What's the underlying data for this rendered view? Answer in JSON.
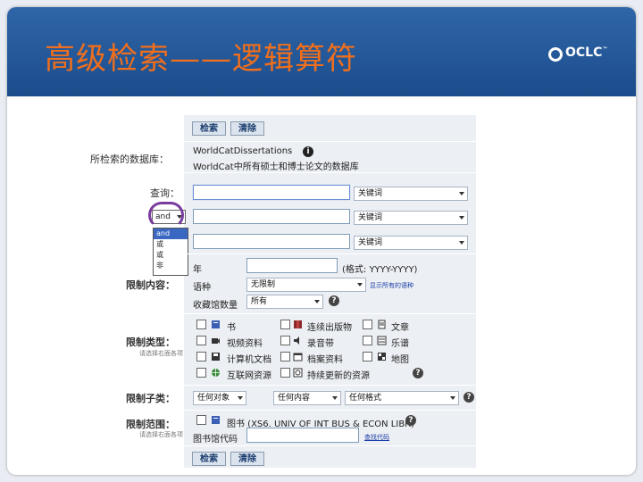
{
  "slide": {
    "title": "高级检索——逻辑算符",
    "logo_text": "OCLC",
    "logo_tm": "™"
  },
  "form": {
    "buttons": {
      "search": "检索",
      "clear": "清除"
    },
    "database": {
      "label": "所检索的数据库：",
      "line1": "WorldCatDissertations",
      "line2": "WorldCat中所有硕士和博士论文的数据库"
    },
    "query": {
      "label": "查询：",
      "field_select": "关键词",
      "operator": "and",
      "operator_options": [
        "and",
        "或",
        "或",
        "非"
      ]
    },
    "limits": {
      "label": "限制内容：",
      "year_label": "年",
      "year_format": "(格式: YYYY-YYYY)",
      "language_label": "语种",
      "language_value": "无限制",
      "language_link": "显示所有的语种",
      "holdings_label": "收藏馆数量",
      "holdings_value": "所有"
    },
    "types": {
      "label": "限制类型：",
      "sub": "请选择右面各项",
      "items": [
        "书",
        "连续出版物",
        "文章",
        "视频资料",
        "录音带",
        "乐谱",
        "计算机文档",
        "档案资料",
        "地图",
        "互联网资源",
        "持续更新的资源"
      ]
    },
    "subtypes": {
      "label": "限制子类：",
      "any_audience": "任何对象",
      "any_content": "任何内容",
      "any_format": "任何格式"
    },
    "scope": {
      "label": "限制范围：",
      "sub": "请选择右面各项",
      "library_item": "图书 (XS6. UNIV OF INT BUS & ECON LIBR)",
      "library_code_label": "图书馆代码",
      "library_code_link": "查找代码"
    }
  },
  "colors": {
    "banner": "#1b4c8b",
    "title": "#ef6f1d",
    "panel": "#eceff3",
    "highlight_ring": "#7a3c9e"
  }
}
